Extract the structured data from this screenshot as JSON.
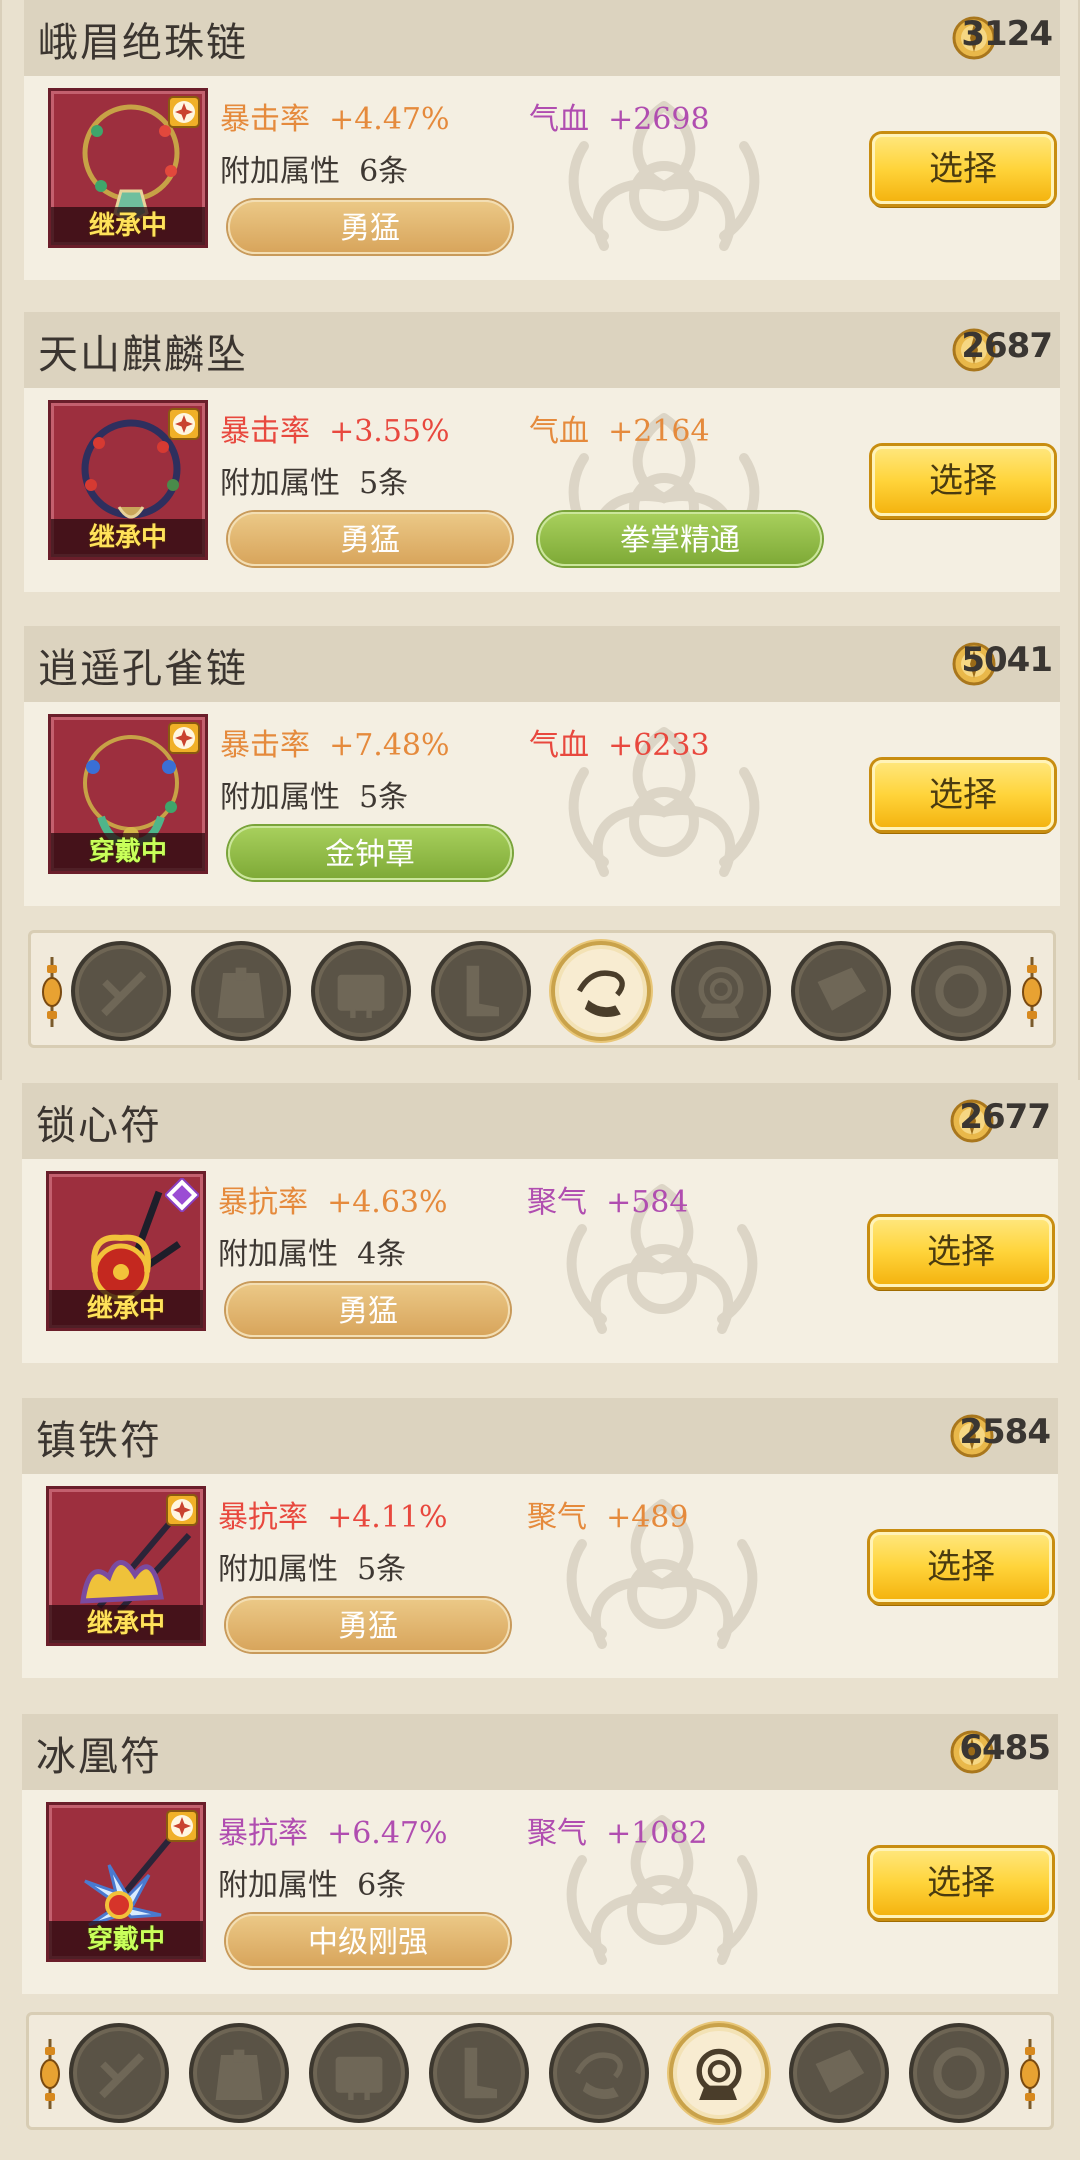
{
  "screens": [
    {
      "cards": [
        {
          "title": "峨眉绝珠链",
          "score": "3124",
          "status": "继承中",
          "status_type": "inherit",
          "rank_icon": "star-seal-icon",
          "stat1": {
            "name": "暴击率",
            "value": "+4.47%",
            "color": "#e58a3c"
          },
          "stat2": {
            "name": "气血",
            "value": "+2698",
            "color": "#b04db0"
          },
          "attr_label": "附加属性",
          "attr_count": "6条",
          "tags": [
            {
              "label": "勇猛",
              "style": "gold"
            }
          ],
          "select_label": "选择"
        },
        {
          "title": "天山麒麟坠",
          "score": "2687",
          "status": "继承中",
          "status_type": "inherit",
          "rank_icon": "star-seal-icon",
          "stat1": {
            "name": "暴击率",
            "value": "+3.55%",
            "color": "#e8483e"
          },
          "stat2": {
            "name": "气血",
            "value": "+2164",
            "color": "#e58a3c"
          },
          "attr_label": "附加属性",
          "attr_count": "5条",
          "tags": [
            {
              "label": "勇猛",
              "style": "gold"
            },
            {
              "label": "拳掌精通",
              "style": "green"
            }
          ],
          "select_label": "选择"
        },
        {
          "title": "逍遥孔雀链",
          "score": "5041",
          "status": "穿戴中",
          "status_type": "wear",
          "rank_icon": "star-seal-icon",
          "stat1": {
            "name": "暴击率",
            "value": "+7.48%",
            "color": "#e58a3c"
          },
          "stat2": {
            "name": "气血",
            "value": "+6233",
            "color": "#e8483e"
          },
          "attr_label": "附加属性",
          "attr_count": "5条",
          "tags": [
            {
              "label": "金钟罩",
              "style": "green"
            }
          ],
          "select_label": "选择"
        }
      ],
      "nav": {
        "active_index": 4
      }
    },
    {
      "cards": [
        {
          "title": "锁心符",
          "score": "2677",
          "status": "继承中",
          "status_type": "inherit",
          "rank_icon": "purple-diamond-icon",
          "stat1": {
            "name": "暴抗率",
            "value": "+4.63%",
            "color": "#e58a3c"
          },
          "stat2": {
            "name": "聚气",
            "value": "+584",
            "color": "#b04db0"
          },
          "attr_label": "附加属性",
          "attr_count": "4条",
          "tags": [
            {
              "label": "勇猛",
              "style": "gold"
            }
          ],
          "select_label": "选择"
        },
        {
          "title": "镇铁符",
          "score": "2584",
          "status": "继承中",
          "status_type": "inherit",
          "rank_icon": "star-seal-icon",
          "stat1": {
            "name": "暴抗率",
            "value": "+4.11%",
            "color": "#e8483e"
          },
          "stat2": {
            "name": "聚气",
            "value": "+489",
            "color": "#e58a3c"
          },
          "attr_label": "附加属性",
          "attr_count": "5条",
          "tags": [
            {
              "label": "勇猛",
              "style": "gold"
            }
          ],
          "select_label": "选择"
        },
        {
          "title": "冰凰符",
          "score": "6485",
          "status": "穿戴中",
          "status_type": "wear",
          "rank_icon": "star-seal-icon",
          "stat1": {
            "name": "暴抗率",
            "value": "+6.47%",
            "color": "#b04db0"
          },
          "stat2": {
            "name": "聚气",
            "value": "+1082",
            "color": "#b04db0"
          },
          "attr_label": "附加属性",
          "attr_count": "6条",
          "tags": [
            {
              "label": "中级刚强",
              "style": "gold"
            }
          ],
          "select_label": "选择"
        }
      ],
      "nav": {
        "active_index": 5
      }
    }
  ],
  "nav_slots": [
    "weapon-slot-icon",
    "armor-slot-icon",
    "belt-slot-icon",
    "boots-slot-icon",
    "necklace-slot-icon",
    "talisman-slot-icon",
    "bracer-slot-icon",
    "ring-slot-icon"
  ]
}
